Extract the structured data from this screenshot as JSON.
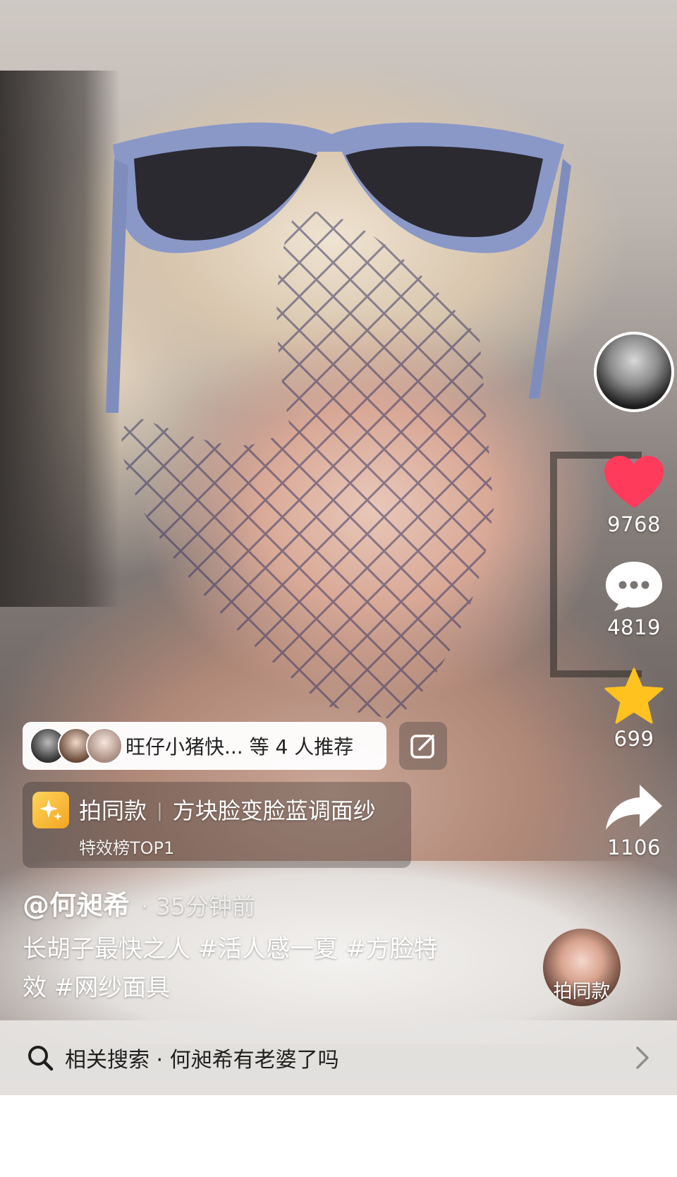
{
  "rail": {
    "likes": "9768",
    "comments": "4819",
    "favorites": "699",
    "shares": "1106"
  },
  "recommend": {
    "text": "旺仔小猪快... 等 4 人推荐"
  },
  "effect": {
    "action": "拍同款",
    "name": "方块脸变脸蓝调面纱",
    "rank": "特效榜TOP1"
  },
  "post": {
    "author": "@何昶希",
    "time": "· 35分钟前",
    "caption_line1": "长胡子最快之人 #活人感一夏 #方脸特",
    "caption_line2": "效 #网纱面具"
  },
  "same_style": {
    "label": "拍同款"
  },
  "search": {
    "text": "相关搜索 · 何昶希有老婆了吗"
  },
  "colors": {
    "like": "#ff3b5c",
    "favorite": "#ffc21f",
    "effect_icon": "#f3a522"
  },
  "icons": [
    "heart-icon",
    "comment-icon",
    "star-icon",
    "share-icon",
    "edit-icon",
    "sparkle-icon",
    "search-icon",
    "chevron-right-icon"
  ]
}
